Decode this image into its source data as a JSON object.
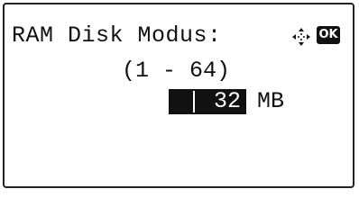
{
  "screen": {
    "title": "RAM Disk Modus:",
    "range": "(1 - 64)",
    "value": "32",
    "unit": "MB",
    "ok_label": "OK",
    "nav_icon": "four-way-arrows-icon"
  }
}
